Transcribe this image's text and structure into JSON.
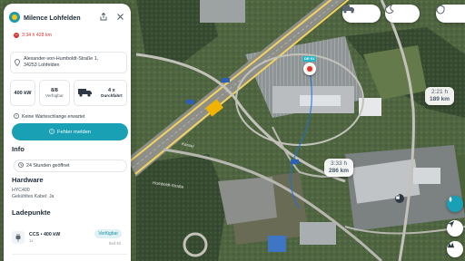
{
  "panel": {
    "title": "Milence Lohfelden",
    "route": "3:34 h 428 km",
    "address": {
      "line1": "Alexander-von-Humboldt-Straße 1,",
      "line2": "34253 Lohfelden"
    },
    "stats": [
      {
        "big": "400 kW",
        "small": ""
      },
      {
        "big": "8/8",
        "small": "Verfügbar"
      },
      {
        "big": "",
        "small": ""
      },
      {
        "big": "4 x",
        "small": "Durchfahrt"
      }
    ],
    "queue_text": "Keine Warteschlange erwartet",
    "report_button": "Fehler melden",
    "info_heading": "Info",
    "hours": "24 Stunden geöffnet",
    "hardware_heading": "Hardware",
    "hardware_model": "HYC400",
    "cable_text": "Gekühltes Kabel: Ja",
    "ladepunkte_heading": "Ladepunkte",
    "ladepunkt": {
      "name": "CCS • 400 kW",
      "count": "1x",
      "status": "Verfügbar",
      "since": "Seit 4h"
    }
  },
  "map": {
    "eta": [
      {
        "time": "2:21 h",
        "dist": "189 km"
      },
      {
        "time": "3:33 h",
        "dist": "286 km"
      }
    ],
    "marker_badge": "DE·01",
    "road_labels": [
      "Humboldt-Straße",
      "Kassel"
    ]
  },
  "colors": {
    "accent": "#19a0b4",
    "route_red": "#dd3333",
    "panel_bg": "#ffffff"
  },
  "icons": [
    "app-logo-icon",
    "share-icon",
    "close-icon",
    "route-icon",
    "map-pin-icon",
    "lightning-icon",
    "truck-icon",
    "warning-icon",
    "clock-icon",
    "plug-icon",
    "truck-mode-icon",
    "moon-icon",
    "shield-icon",
    "navigate-icon",
    "layers-icon",
    "lock-icon"
  ]
}
